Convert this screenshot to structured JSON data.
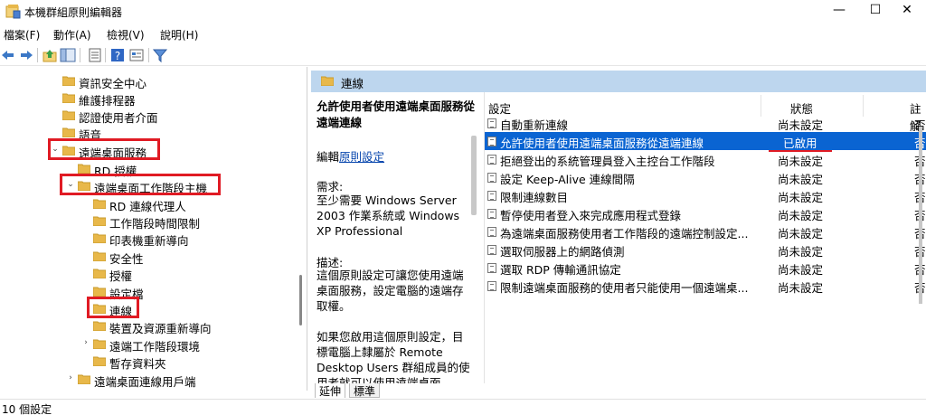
{
  "window": {
    "title": "本機群組原則編輯器",
    "minimize": "—",
    "maximize": "☐",
    "close": "✕"
  },
  "menu": [
    "檔案(F)",
    "動作(A)",
    "檢視(V)",
    "說明(H)"
  ],
  "toolbar_icons": [
    "back-arrow-icon",
    "forward-arrow-icon",
    "up-folder-icon",
    "show-hide-tree-icon",
    "export-list-icon",
    "help-icon",
    "properties-icon",
    "filter-icon"
  ],
  "tree": {
    "items": [
      {
        "label": "資訊安全中心",
        "level": 0
      },
      {
        "label": "維護排程器",
        "level": 0
      },
      {
        "label": "認證使用者介面",
        "level": 0
      },
      {
        "label": "語音",
        "level": 0
      },
      {
        "label": "遠端桌面服務",
        "level": 0,
        "expanded": true
      },
      {
        "label": "RD 授權",
        "level": 1
      },
      {
        "label": "遠端桌面工作階段主機",
        "level": 1,
        "expanded": true
      },
      {
        "label": "RD 連線代理人",
        "level": 2
      },
      {
        "label": "工作階段時間限制",
        "level": 2
      },
      {
        "label": "印表機重新導向",
        "level": 2
      },
      {
        "label": "安全性",
        "level": 2
      },
      {
        "label": "授權",
        "level": 2
      },
      {
        "label": "設定檔",
        "level": 2
      },
      {
        "label": "連線",
        "level": 2,
        "selected": true
      },
      {
        "label": "裝置及資源重新導向",
        "level": 2
      },
      {
        "label": "遠端工作階段環境",
        "level": 2,
        "collapsed": true
      },
      {
        "label": "暫存資料夾",
        "level": 2
      },
      {
        "label": "遠端桌面連線用戶端",
        "level": 0,
        "collapsed": true
      }
    ]
  },
  "detail": {
    "header": "連線",
    "title": "允許使用者使用遠端桌面服務從遠端連線",
    "edit_prefix": "編輯",
    "edit_link": "原則設定",
    "requirements_heading": "需求:",
    "requirements": "至少需要 Windows Server 2003 作業系統或 Windows XP Professional",
    "description_heading": "描述:",
    "description": "這個原則設定可讓您使用遠端桌面服務，設定電腦的遠端存取權。",
    "description_more": "如果您啟用這個原則設定，目標電腦上隸屬於 Remote Desktop Users 群組成員的使用者就可以使用遠端桌面"
  },
  "list": {
    "columns": [
      "設定",
      "狀態",
      "註解"
    ],
    "rows": [
      {
        "name": "自動重新連線",
        "state": "尚未設定",
        "note": "否"
      },
      {
        "name": "允許使用者使用遠端桌面服務從遠端連線",
        "state": "已啟用",
        "note": "否",
        "selected": true
      },
      {
        "name": "拒絕登出的系統管理員登入主控台工作階段",
        "state": "尚未設定",
        "note": "否"
      },
      {
        "name": "設定 Keep-Alive 連線間隔",
        "state": "尚未設定",
        "note": "否"
      },
      {
        "name": "限制連線數目",
        "state": "尚未設定",
        "note": "否"
      },
      {
        "name": "暫停使用者登入來完成應用程式登錄",
        "state": "尚未設定",
        "note": "否"
      },
      {
        "name": "為遠端桌面服務使用者工作階段的遠端控制設定...",
        "state": "尚未設定",
        "note": "否"
      },
      {
        "name": "選取伺服器上的網路偵測",
        "state": "尚未設定",
        "note": "否"
      },
      {
        "name": "選取 RDP 傳輸通訊協定",
        "state": "尚未設定",
        "note": "否"
      },
      {
        "name": "限制遠端桌面服務的使用者只能使用一個遠端桌...",
        "state": "尚未設定",
        "note": "否"
      }
    ]
  },
  "tabs": [
    "延伸",
    "標準"
  ],
  "status": "10 個設定",
  "colors": {
    "selection": "#0a64d2",
    "header_band": "#bdd6ee",
    "highlight_box": "#e01b24",
    "folder": "#e8b84a"
  }
}
